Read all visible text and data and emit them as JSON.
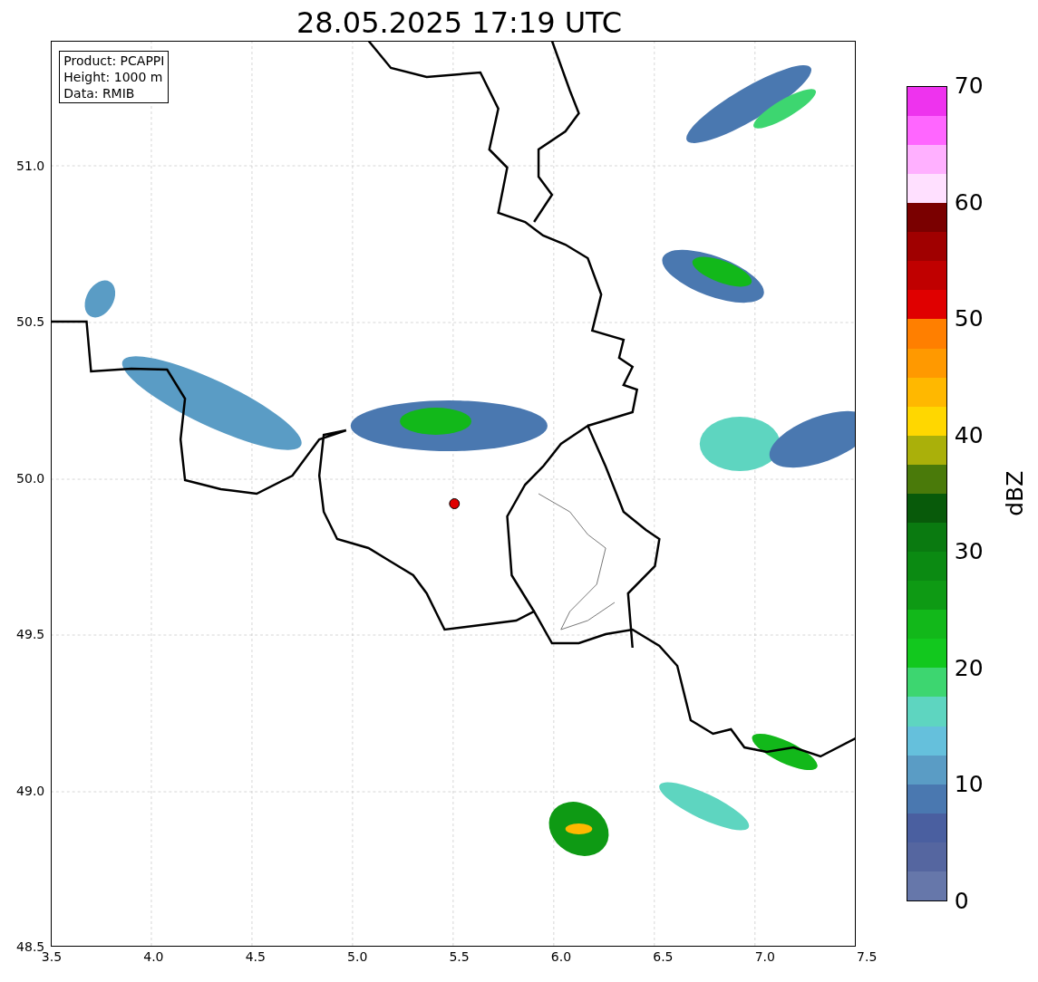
{
  "title": "28.05.2025 17:19 UTC",
  "info_box": [
    "Product: PCAPPI",
    "Height: 1000 m",
    "Data: RMIB"
  ],
  "y_ticks": [
    "51.0",
    "50.5",
    "50.0",
    "49.5",
    "49.0",
    "48.5"
  ],
  "x_ticks": [
    "3.5",
    "4.0",
    "4.5",
    "5.0",
    "5.5",
    "6.0",
    "6.5",
    "7.0",
    "7.5"
  ],
  "colorbar": {
    "label": "dBZ",
    "ticks": [
      "70",
      "60",
      "50",
      "40",
      "30",
      "20",
      "10",
      "0"
    ],
    "segments": [
      {
        "color": "#6677aa"
      },
      {
        "color": "#5566a0"
      },
      {
        "color": "#4a5fa0"
      },
      {
        "color": "#4a78b0"
      },
      {
        "color": "#5a9cc5"
      },
      {
        "color": "#65c0dc"
      },
      {
        "color": "#5ed5c0"
      },
      {
        "color": "#3dd670"
      },
      {
        "color": "#12c81e"
      },
      {
        "color": "#12b81a"
      },
      {
        "color": "#0e9a14"
      },
      {
        "color": "#0b8a12"
      },
      {
        "color": "#0a7a10"
      },
      {
        "color": "#085a0a"
      },
      {
        "color": "#4a7a0a"
      },
      {
        "color": "#aab00a"
      },
      {
        "color": "#ffd700"
      },
      {
        "color": "#ffb800"
      },
      {
        "color": "#ff9900"
      },
      {
        "color": "#ff7f00"
      },
      {
        "color": "#e00000"
      },
      {
        "color": "#c00000"
      },
      {
        "color": "#a00000"
      },
      {
        "color": "#7a0000"
      },
      {
        "color": "#ffe0ff"
      },
      {
        "color": "#ffb0ff"
      },
      {
        "color": "#ff66ff"
      },
      {
        "color": "#ee33ee"
      }
    ]
  }
}
